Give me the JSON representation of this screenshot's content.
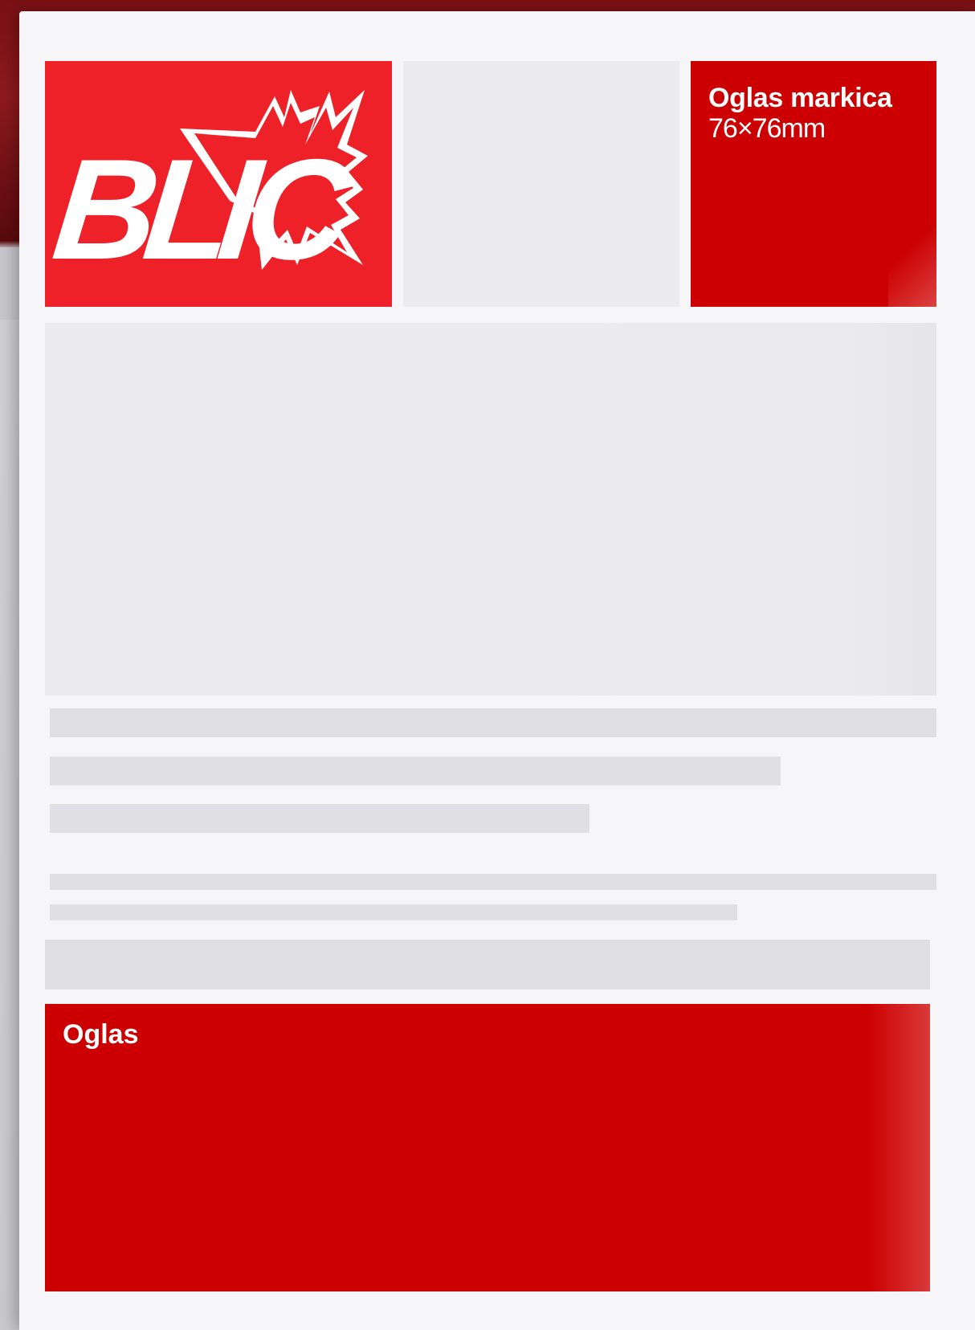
{
  "logo": {
    "text": "BLIC",
    "icon": "blic-burst-logo-icon",
    "background_color": "#ee2129"
  },
  "ad_stamp": {
    "title": "Oglas markica",
    "size": "76×76mm",
    "color": "#cc0000"
  },
  "ad_banner": {
    "label": "Oglas",
    "color": "#cc0000"
  },
  "colors": {
    "skeleton": "#dfdfe4",
    "placeholder": "#ececf0",
    "page": "#f6f6f8"
  }
}
